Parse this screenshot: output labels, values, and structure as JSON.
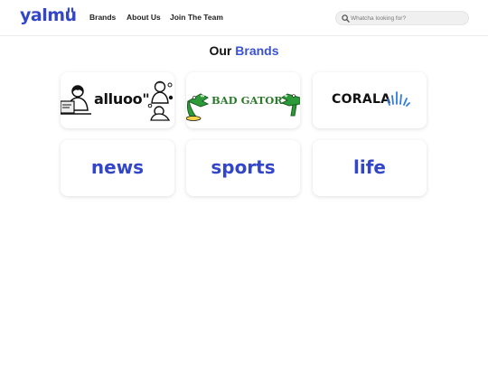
{
  "header": {
    "logo_text": "yalmu",
    "logo_mark": "\"",
    "nav": [
      {
        "label": "Brands"
      },
      {
        "label": "About Us"
      },
      {
        "label": "Join The Team"
      }
    ],
    "search": {
      "placeholder": "Whatcha looking for?",
      "icon": "search-icon"
    }
  },
  "main": {
    "title_prefix": "Our",
    "title_accent": "Brands",
    "brands": [
      {
        "name": "alluoo\"",
        "style": "logo-illustrated"
      },
      {
        "name": "BAD GATOR",
        "style": "logo-gator"
      },
      {
        "name": "CORALA",
        "style": "logo-corala"
      },
      {
        "name": "news",
        "style": "text"
      },
      {
        "name": "sports",
        "style": "text"
      },
      {
        "name": "life",
        "style": "text"
      }
    ]
  },
  "colors": {
    "brand_blue": "#3346c8",
    "accent_blue": "#3a52d4",
    "gator_green": "#2d9a3a",
    "corala_blue": "#2f7be0"
  }
}
